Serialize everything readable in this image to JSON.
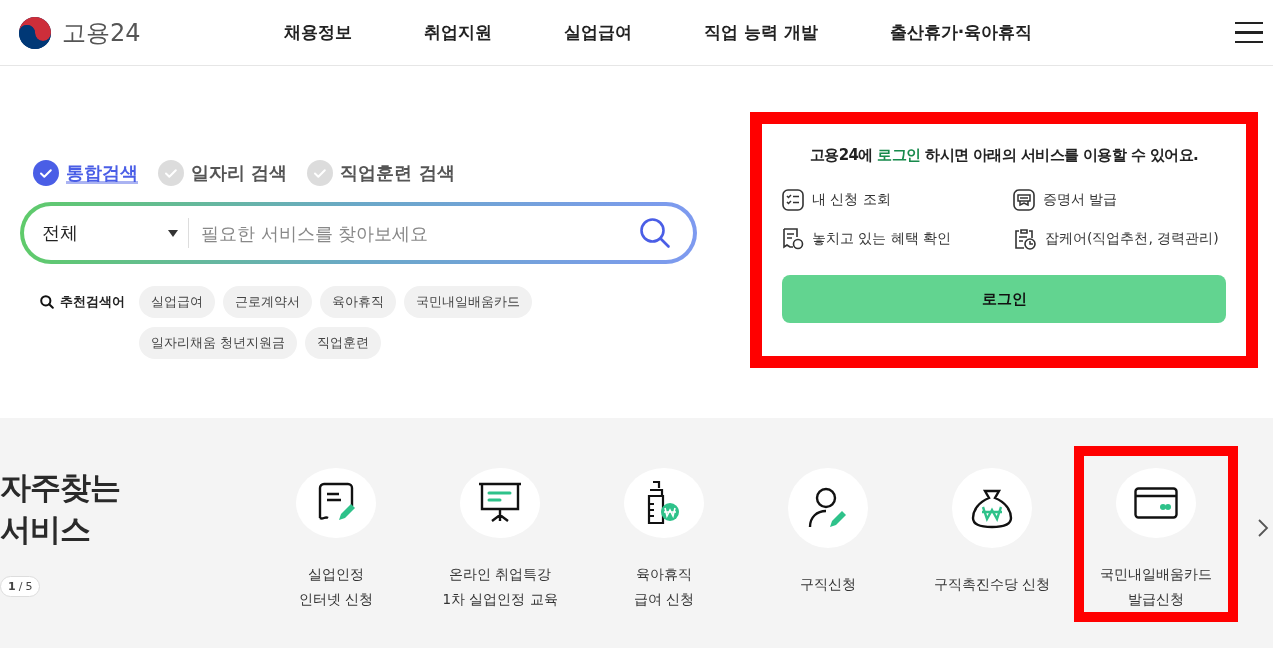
{
  "header": {
    "logo_text": "고용24",
    "nav": [
      "채용정보",
      "취업지원",
      "실업급여",
      "직업 능력 개발",
      "출산휴가·육아휴직"
    ]
  },
  "search": {
    "tabs": [
      {
        "label": "통합검색",
        "selected": true
      },
      {
        "label": "일자리 검색",
        "selected": false
      },
      {
        "label": "직업훈련 검색",
        "selected": false
      }
    ],
    "category": "전체",
    "placeholder": "필요한 서비스를 찾아보세요",
    "recommended_label": "추천검색어",
    "keywords": [
      "실업급여",
      "근로계약서",
      "육아휴직",
      "국민내일배움카드",
      "일자리채움 청년지원금",
      "직업훈련"
    ]
  },
  "login_panel": {
    "highlighted": true,
    "message": "고용24에 **로그인** 하시면 아래의 서비스를 이용할 수 있어요.",
    "features": [
      "내 신청 조회",
      "증명서 발급",
      "놓치고 있는 혜택 확인",
      "잡케어(직업추천, 경력관리)"
    ],
    "button": "로그인"
  },
  "frequent_services": {
    "title_lines": [
      "자주찾는",
      "서비스"
    ],
    "page_current": "1",
    "page_separator": "/",
    "page_total": "5",
    "items": [
      {
        "lines": [
          "실업인정",
          "인터넷 신청"
        ],
        "highlighted": false
      },
      {
        "lines": [
          "온라인 취업특강",
          "1차 실업인정 교육"
        ],
        "highlighted": false
      },
      {
        "lines": [
          "육아휴직",
          "급여 신청"
        ],
        "highlighted": false
      },
      {
        "lines": [
          "구직신청"
        ],
        "highlighted": false
      },
      {
        "lines": [
          "구직촉진수당 신청"
        ],
        "highlighted": false
      },
      {
        "lines": [
          "국민내일배움카드",
          "발급신청"
        ],
        "highlighted": true
      }
    ]
  }
}
